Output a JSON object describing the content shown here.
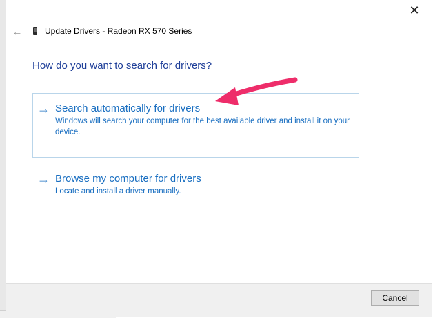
{
  "window": {
    "title": "Update Drivers - Radeon RX 570 Series",
    "close_glyph": "✕",
    "back_glyph": "←"
  },
  "main": {
    "heading": "How do you want to search for drivers?",
    "options": [
      {
        "title": "Search automatically for drivers",
        "description": "Windows will search your computer for the best available driver and install it on your device.",
        "arrow_glyph": "→"
      },
      {
        "title": "Browse my computer for drivers",
        "description": "Locate and install a driver manually.",
        "arrow_glyph": "→"
      }
    ]
  },
  "footer": {
    "cancel_label": "Cancel"
  },
  "colors": {
    "link_blue": "#1a6fc1",
    "heading_blue": "#1f3f99",
    "annotation_pink": "#ee2d6a"
  },
  "icons": {
    "device": "graphics-card-icon",
    "back": "back-arrow-icon",
    "close": "close-icon",
    "option": "right-arrow-icon"
  }
}
